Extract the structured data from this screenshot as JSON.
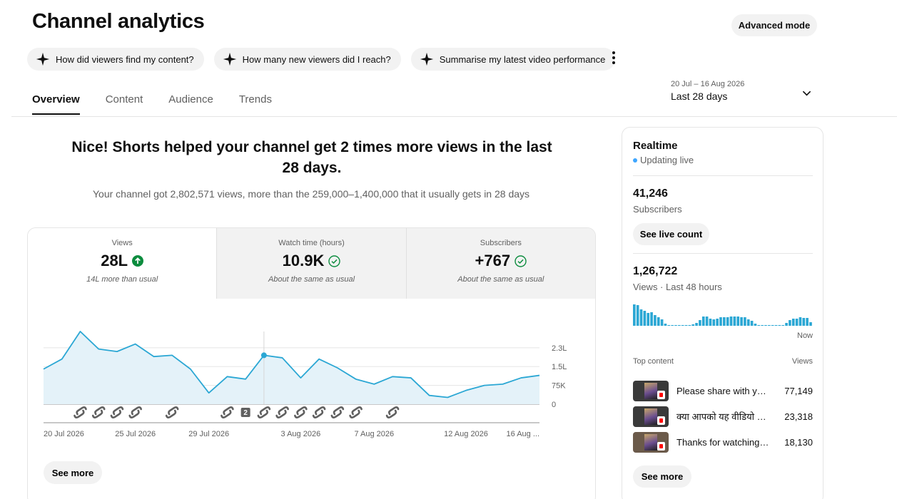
{
  "header": {
    "title": "Channel analytics",
    "advanced_mode": "Advanced mode"
  },
  "chips": [
    {
      "label": "How did viewers find my content?",
      "icon": "sparkle-icon"
    },
    {
      "label": "How many new viewers did I reach?",
      "icon": "sparkle-icon"
    },
    {
      "label": "Summarise my latest video performance",
      "icon": "sparkle-icon"
    }
  ],
  "tabs": [
    {
      "label": "Overview",
      "active": true
    },
    {
      "label": "Content",
      "active": false
    },
    {
      "label": "Audience",
      "active": false
    },
    {
      "label": "Trends",
      "active": false
    }
  ],
  "date_picker": {
    "range": "20 Jul – 16 Aug 2026",
    "label": "Last 28 days"
  },
  "summary": {
    "headline": "Nice! Shorts helped your channel get 2 times more views in the last 28 days.",
    "detail": "Your channel got 2,802,571 views, more than the 259,000–1,400,000 that it usually gets in 28 days"
  },
  "metrics": [
    {
      "name": "Views",
      "value": "28L",
      "note": "14L more than usual",
      "status": "up",
      "active": true
    },
    {
      "name": "Watch time (hours)",
      "value": "10.9K",
      "note": "About the same as usual",
      "status": "ok",
      "active": false
    },
    {
      "name": "Subscribers",
      "value": "+767",
      "note": "About the same as usual",
      "status": "ok",
      "active": false
    }
  ],
  "colors": {
    "line": "#2ba7d4",
    "area": "#e4f2f9",
    "up_green": "#0c8c3e",
    "live_dot": "#3ea6ff"
  },
  "chart_data": {
    "type": "area",
    "metric": "Views",
    "x": [
      "20 Jul",
      "21 Jul",
      "22 Jul",
      "23 Jul",
      "24 Jul",
      "25 Jul",
      "26 Jul",
      "27 Jul",
      "28 Jul",
      "29 Jul",
      "30 Jul",
      "31 Jul",
      "1 Aug",
      "2 Aug",
      "3 Aug",
      "4 Aug",
      "5 Aug",
      "6 Aug",
      "7 Aug",
      "8 Aug",
      "9 Aug",
      "10 Aug",
      "11 Aug",
      "12 Aug",
      "13 Aug",
      "14 Aug",
      "15 Aug",
      "16 Aug"
    ],
    "values": [
      1400000,
      1800000,
      2900000,
      2200000,
      2100000,
      2400000,
      1900000,
      1950000,
      1400000,
      450000,
      1100000,
      1000000,
      1950000,
      1850000,
      1050000,
      1800000,
      1450000,
      1000000,
      800000,
      1100000,
      1050000,
      350000,
      270000,
      550000,
      750000,
      800000,
      1050000,
      1150000
    ],
    "highlight_index": 12,
    "y_ticks": [
      "2.3L",
      "1.5L",
      "75K",
      "0"
    ],
    "y_tick_values": [
      2250000,
      1500000,
      750000,
      0
    ],
    "ylim": [
      0,
      2900000
    ],
    "x_tick_labels": [
      {
        "index": 0,
        "label": "20 Jul 2026"
      },
      {
        "index": 5,
        "label": "25 Jul 2026"
      },
      {
        "index": 9,
        "label": "29 Jul 2026"
      },
      {
        "index": 14,
        "label": "3 Aug 2026"
      },
      {
        "index": 18,
        "label": "7 Aug 2026"
      },
      {
        "index": 23,
        "label": "12 Aug 2026"
      },
      {
        "index": 27,
        "label": "16 Aug ..."
      }
    ],
    "upload_markers": [
      {
        "index": 2,
        "label": ""
      },
      {
        "index": 3,
        "label": ""
      },
      {
        "index": 4,
        "label": ""
      },
      {
        "index": 5,
        "label": ""
      },
      {
        "index": 7,
        "label": ""
      },
      {
        "index": 10,
        "label": ""
      },
      {
        "index": 11,
        "label": "2"
      },
      {
        "index": 12,
        "label": ""
      },
      {
        "index": 13,
        "label": ""
      },
      {
        "index": 14,
        "label": ""
      },
      {
        "index": 15,
        "label": ""
      },
      {
        "index": 16,
        "label": ""
      },
      {
        "index": 17,
        "label": ""
      },
      {
        "index": 19,
        "label": ""
      }
    ],
    "grid": true
  },
  "see_more": "See more",
  "realtime": {
    "title": "Realtime",
    "status": "Updating live",
    "subscribers": "41,246",
    "subscribers_label": "Subscribers",
    "see_live_count": "See live count",
    "views": "1,26,722",
    "views_label": "Views · Last 48 hours",
    "now_label": "Now",
    "bars": [
      30,
      29,
      23,
      21,
      18,
      19,
      15,
      12,
      9,
      3,
      1,
      1,
      1,
      1,
      1,
      1,
      1,
      2,
      4,
      8,
      13,
      13,
      10,
      9,
      10,
      12,
      12,
      12,
      13,
      13,
      13,
      12,
      12,
      9,
      7,
      3,
      1,
      1,
      1,
      1,
      1,
      1,
      1,
      1,
      4,
      8,
      10,
      10,
      12,
      11,
      11,
      5
    ],
    "top_content_label": "Top content",
    "views_header": "Views",
    "top_content": [
      {
        "title": "Please share with you…",
        "views": "77,149"
      },
      {
        "title": "क्या आपको यह वीडियो …",
        "views": "23,318"
      },
      {
        "title": "Thanks for watching I…",
        "views": "18,130"
      }
    ],
    "see_more": "See more"
  }
}
